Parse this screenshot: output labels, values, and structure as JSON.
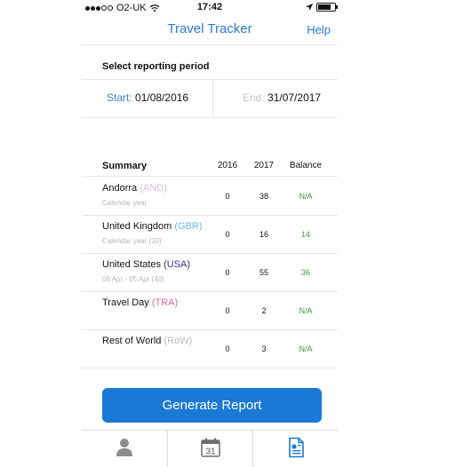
{
  "status_bar": {
    "carrier": "O2-UK",
    "time": "17:42",
    "battery_level": 0.85
  },
  "nav": {
    "title": "Travel Tracker",
    "help_label": "Help"
  },
  "period": {
    "section_label": "Select reporting period",
    "start_label": "Start:",
    "start_value": "01/08/2016",
    "end_label": "End:",
    "end_value": "31/07/2017"
  },
  "summary": {
    "headers": {
      "title": "Summary",
      "col1": "2016",
      "col2": "2017",
      "col3": "Balance"
    },
    "rows": [
      {
        "name": "Andorra",
        "code": "(AND)",
        "code_color": "#d9c2d3",
        "sub": "Calendar year",
        "y2016": "0",
        "y2017": "38",
        "balance": "N/A",
        "balance_color": "#3a9a3a"
      },
      {
        "name": "United Kingdom",
        "code": "(GBR)",
        "code_color": "#6bb7ea",
        "sub": "Calendar year (30)",
        "y2016": "0",
        "y2017": "16",
        "balance": "14",
        "balance_color": "#3a9a3a"
      },
      {
        "name": "United States",
        "code": "(USA)",
        "code_color": "#3c2f9a",
        "sub": "06 Apr - 05 Apr (40)",
        "y2016": "0",
        "y2017": "55",
        "balance": "36",
        "balance_color": "#3a9a3a"
      },
      {
        "name": "Travel Day",
        "code": "(TRA)",
        "code_color": "#e0679a",
        "sub": "",
        "y2016": "0",
        "y2017": "2",
        "balance": "N/A",
        "balance_color": "#3a9a3a"
      },
      {
        "name": "Rest of World",
        "code": "(RoW)",
        "code_color": "#bdbdbd",
        "sub": "",
        "y2016": "0",
        "y2017": "3",
        "balance": "N/A",
        "balance_color": "#3a9a3a"
      }
    ]
  },
  "generate_button": {
    "label": "Generate Report"
  },
  "tabbar": {
    "tabs": [
      {
        "icon": "person-icon",
        "active": false
      },
      {
        "icon": "calendar-icon",
        "label": "31",
        "active": false
      },
      {
        "icon": "report-icon",
        "active": true
      }
    ]
  },
  "colors": {
    "accent": "#1b79d6",
    "link": "#2a7ad6",
    "positive": "#3a9a3a",
    "inactive_icon": "#8e8e8e"
  }
}
